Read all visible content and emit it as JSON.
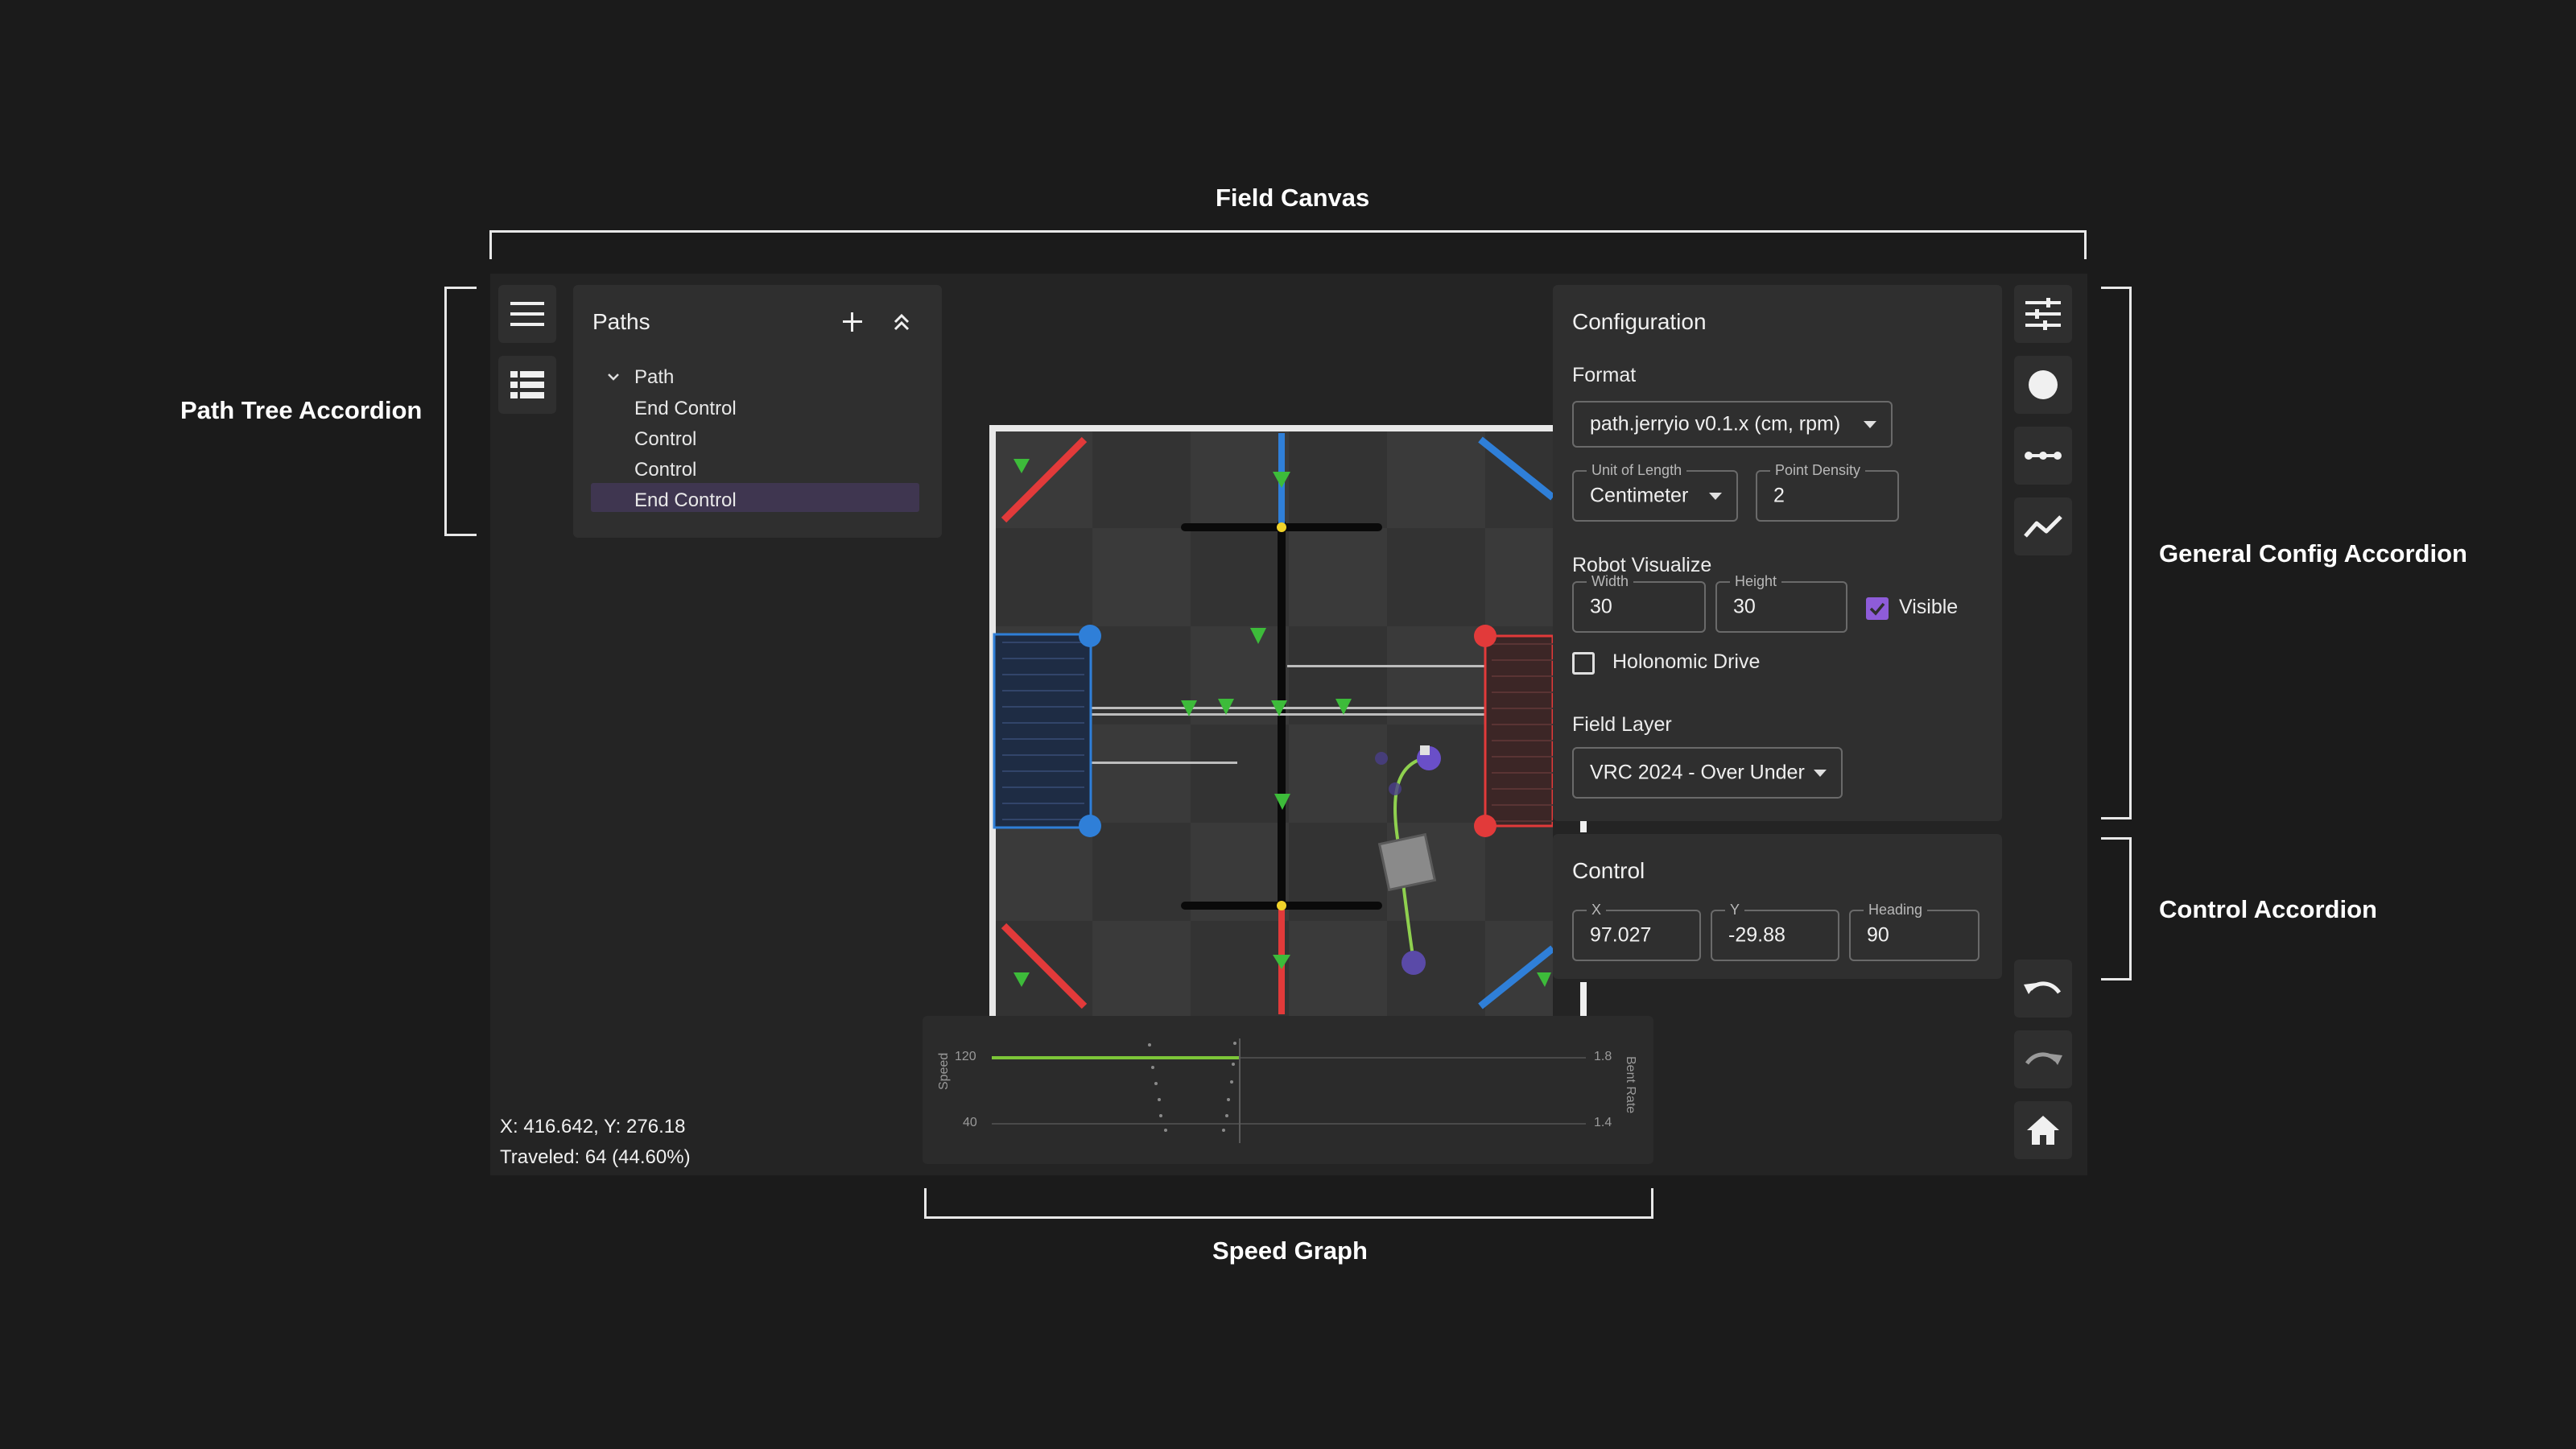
{
  "annotations": {
    "field_canvas": "Field Canvas",
    "path_tree": "Path Tree Accordion",
    "general_config": "General Config Accordion",
    "control_accordion": "Control Accordion",
    "speed_graph": "Speed Graph"
  },
  "paths_panel": {
    "title": "Paths",
    "items": [
      "Path",
      "End Control",
      "Control",
      "Control",
      "End Control"
    ]
  },
  "config": {
    "title": "Configuration",
    "format_label": "Format",
    "format_value": "path.jerryio v0.1.x (cm, rpm)",
    "unit_label": "Unit of Length",
    "unit_value": "Centimeter",
    "density_label": "Point Density",
    "density_value": "2",
    "robot_label": "Robot Visualize",
    "width_label": "Width",
    "width_value": "30",
    "height_label": "Height",
    "height_value": "30",
    "visible_label": "Visible",
    "visible_checked": true,
    "holonomic_label": "Holonomic Drive",
    "holonomic_checked": false,
    "field_layer_label": "Field Layer",
    "field_layer_value": "VRC 2024 - Over Under"
  },
  "control": {
    "title": "Control",
    "x_label": "X",
    "x_value": "97.027",
    "y_label": "Y",
    "y_value": "-29.88",
    "heading_label": "Heading",
    "heading_value": "90"
  },
  "status": {
    "coords": "X: 416.642, Y: 276.18",
    "traveled": "Traveled: 64 (44.60%)"
  },
  "speed_graph": {
    "y_left_label": "Speed",
    "y_right_label": "Bent Rate",
    "left_ticks": [
      "120",
      "40"
    ],
    "right_ticks": [
      "1.8",
      "1.4"
    ]
  },
  "icons": {
    "menu": "menu-icon",
    "tree": "list-icon",
    "settings": "tune-icon",
    "circle": "circle-icon",
    "segment": "segment-icon",
    "graph": "graph-icon",
    "undo": "undo-icon",
    "redo": "redo-icon",
    "home": "home-icon"
  },
  "colors": {
    "accent": "#8e5cd9",
    "path": "#8fd14f",
    "alliance_red": "#e23a3a",
    "alliance_blue": "#2f7fd8",
    "triball": "#3dbb3a"
  }
}
